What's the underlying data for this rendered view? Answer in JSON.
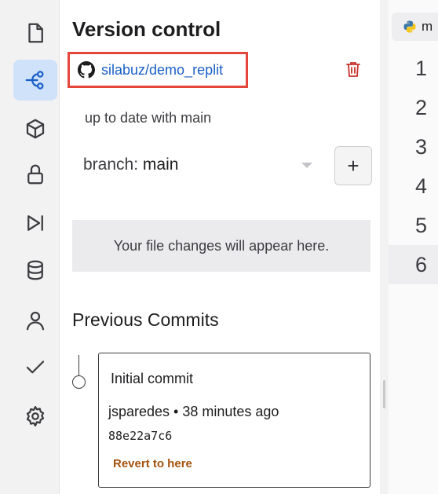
{
  "sidebar": {
    "icons": [
      {
        "name": "file-icon",
        "active": false
      },
      {
        "name": "version-control-icon",
        "active": true
      },
      {
        "name": "packages-icon",
        "active": false
      },
      {
        "name": "secrets-lock-icon",
        "active": false
      },
      {
        "name": "debugger-icon",
        "active": false
      },
      {
        "name": "database-icon",
        "active": false
      },
      {
        "name": "user-icon",
        "active": false
      },
      {
        "name": "checkmark-icon",
        "active": false
      },
      {
        "name": "settings-gear-icon",
        "active": false
      }
    ]
  },
  "panel": {
    "title": "Version control",
    "repo": "silabuz/demo_replit",
    "status": "up to date with main",
    "branch_prefix": "branch: ",
    "branch_value": "main",
    "add_branch_label": "+",
    "changes_placeholder": "Your file changes will appear here.",
    "previous_commits_title": "Previous Commits",
    "commits": [
      {
        "message": "Initial commit",
        "meta": "jsparedes • 38 minutes ago",
        "hash": "88e22a7c6",
        "revert_label": "Revert to here"
      }
    ]
  },
  "editor": {
    "tab_label": "m",
    "line_numbers": [
      "1",
      "2",
      "3",
      "4",
      "5",
      "6"
    ],
    "current_line": "6"
  },
  "colors": {
    "accent": "#1a5fc7",
    "highlight_border": "#e5463b",
    "trash": "#c7322b",
    "revert": "#a3530f"
  }
}
